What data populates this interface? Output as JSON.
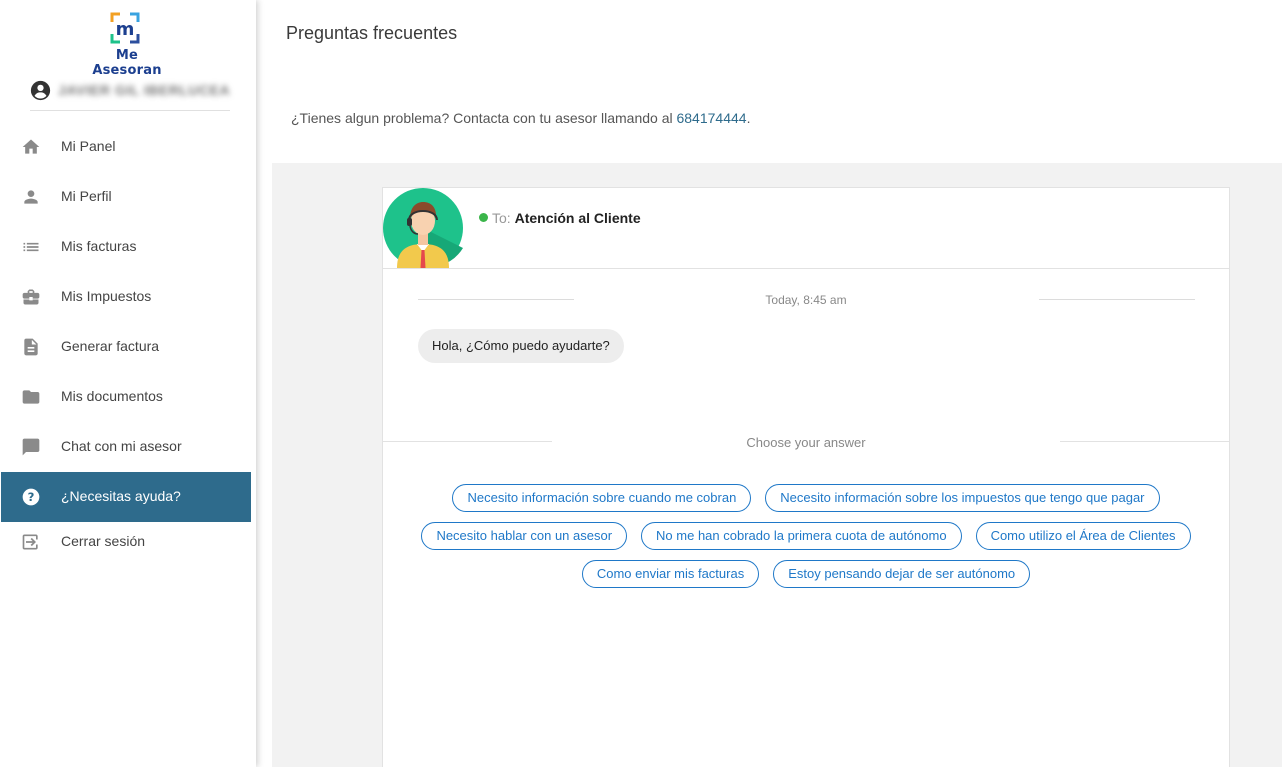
{
  "brand": {
    "name": "Me Asesoran",
    "mark_letter": "m"
  },
  "user": {
    "name": "JAVIER GIL IBERLUCEA"
  },
  "sidebar": {
    "items": [
      {
        "label": "Mi Panel",
        "icon": "home-icon"
      },
      {
        "label": "Mi Perfil",
        "icon": "person-icon"
      },
      {
        "label": "Mis facturas",
        "icon": "list-icon"
      },
      {
        "label": "Mis Impuestos",
        "icon": "briefcase-icon"
      },
      {
        "label": "Generar factura",
        "icon": "document-icon"
      },
      {
        "label": "Mis documentos",
        "icon": "folder-icon"
      },
      {
        "label": "Chat con mi asesor",
        "icon": "chat-icon"
      },
      {
        "label": "¿Necesitas ayuda?",
        "icon": "help-icon",
        "active": true
      },
      {
        "label": "Cerrar sesión",
        "icon": "logout-icon"
      }
    ]
  },
  "main": {
    "title": "Preguntas frecuentes",
    "contact_text": "¿Tienes algun problema? Contacta con tu asesor llamando al ",
    "contact_phone": "684174444",
    "contact_end": "."
  },
  "chat": {
    "to_prefix": "To: ",
    "to_name": "Atención al Cliente",
    "timestamp": "Today, 8:45 am",
    "message": "Hola, ¿Cómo puedo ayudarte?",
    "choose_label": "Choose your answer",
    "answers": [
      "Necesito información sobre cuando me cobran",
      "Necesito información sobre los impuestos que tengo que pagar",
      "Necesito hablar con un asesor",
      "No me han cobrado la primera cuota de autónomo",
      "Como utilizo el Área de Clientes",
      "Como enviar mis facturas",
      "Estoy pensando dejar de ser autónomo"
    ]
  },
  "colors": {
    "active_nav": "#2e6b8c",
    "answer_accent": "#1f78c8",
    "online": "#3bb54a",
    "avatar_bg": "#1ec28b",
    "brand_text": "#1c3f8f"
  }
}
